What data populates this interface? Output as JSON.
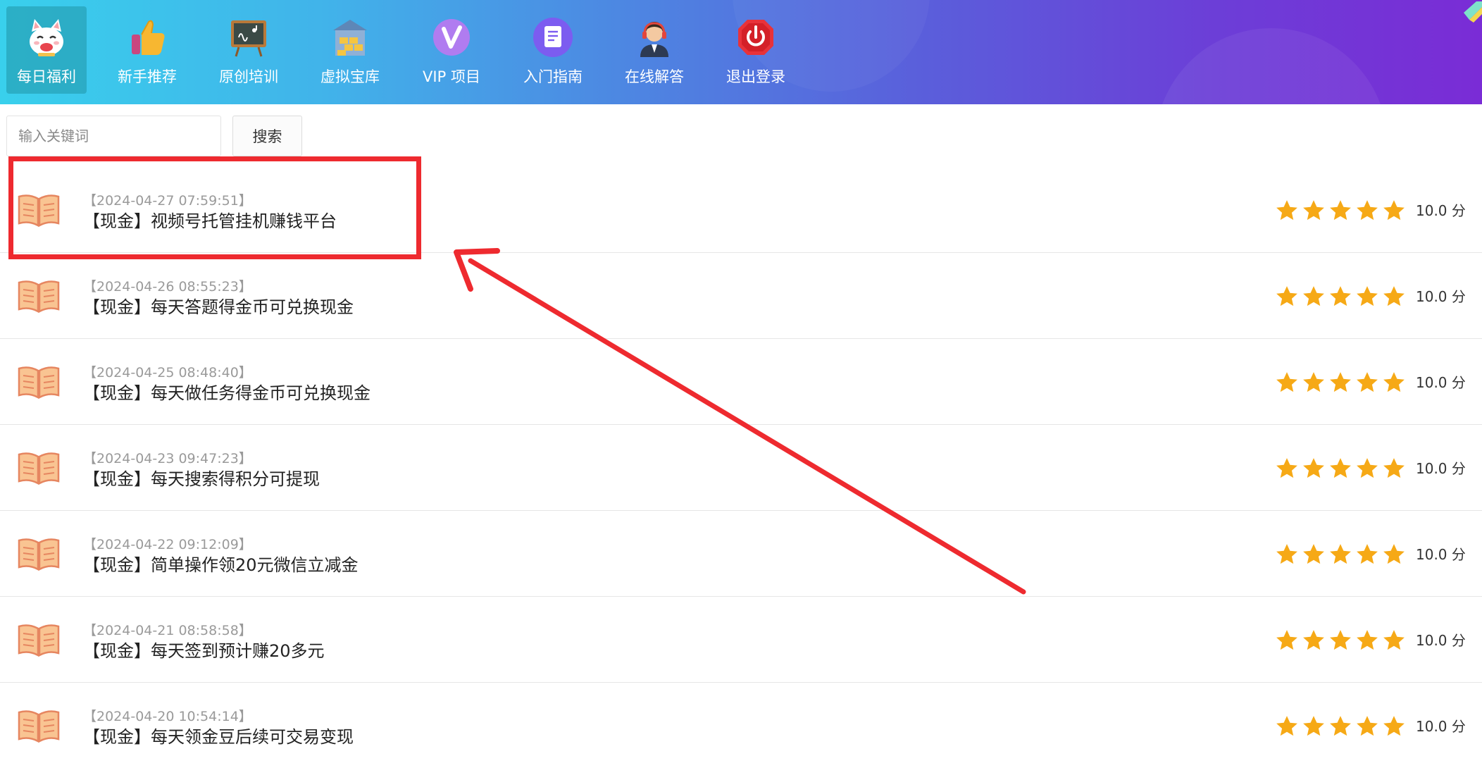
{
  "nav": {
    "items": [
      {
        "label": "每日福利",
        "icon": "lucky-cat-icon",
        "active": true
      },
      {
        "label": "新手推荐",
        "icon": "thumbs-up-icon",
        "active": false
      },
      {
        "label": "原创培训",
        "icon": "blackboard-icon",
        "active": false
      },
      {
        "label": "虚拟宝库",
        "icon": "treasure-house-icon",
        "active": false
      },
      {
        "label": "VIP 项目",
        "icon": "vip-badge-icon",
        "active": false
      },
      {
        "label": "入门指南",
        "icon": "document-icon",
        "active": false
      },
      {
        "label": "在线解答",
        "icon": "support-agent-icon",
        "active": false
      },
      {
        "label": "退出登录",
        "icon": "power-icon",
        "active": false
      }
    ]
  },
  "search": {
    "placeholder": "输入关键词",
    "value": "",
    "button_label": "搜索"
  },
  "list": {
    "items": [
      {
        "date": "【2024-04-27 07:59:51】",
        "title": "【现金】视频号托管挂机赚钱平台",
        "rating": 5,
        "score": "10.0 分"
      },
      {
        "date": "【2024-04-26 08:55:23】",
        "title": "【现金】每天答题得金币可兑换现金",
        "rating": 5,
        "score": "10.0 分"
      },
      {
        "date": "【2024-04-25 08:48:40】",
        "title": "【现金】每天做任务得金币可兑换现金",
        "rating": 5,
        "score": "10.0 分"
      },
      {
        "date": "【2024-04-23 09:47:23】",
        "title": "【现金】每天搜索得积分可提现",
        "rating": 5,
        "score": "10.0 分"
      },
      {
        "date": "【2024-04-22 09:12:09】",
        "title": "【现金】简单操作领20元微信立减金",
        "rating": 5,
        "score": "10.0 分"
      },
      {
        "date": "【2024-04-21 08:58:58】",
        "title": "【现金】每天签到预计赚20多元",
        "rating": 5,
        "score": "10.0 分"
      },
      {
        "date": "【2024-04-20 10:54:14】",
        "title": "【现金】每天领金豆后续可交易变现",
        "rating": 5,
        "score": "10.0 分"
      }
    ]
  },
  "colors": {
    "annotation_red": "#ee2a2f",
    "star_gold": "#f6a916",
    "nav_gradient_start": "#39d0ec",
    "nav_gradient_end": "#7a2cd6"
  }
}
